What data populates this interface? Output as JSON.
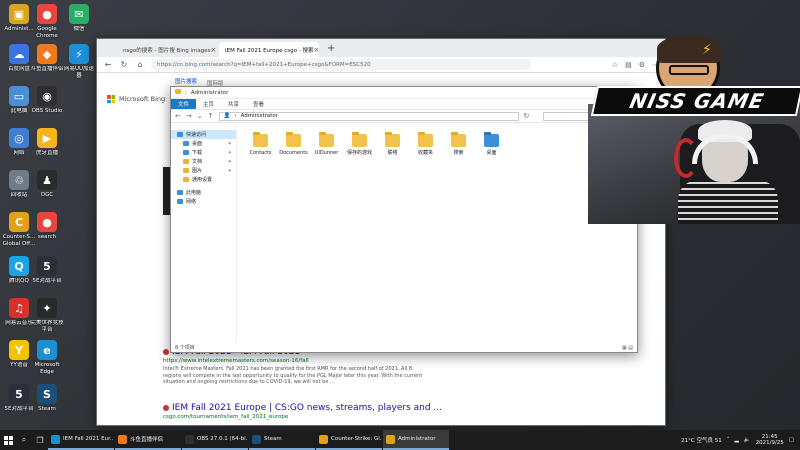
{
  "desktop": {
    "icons": [
      {
        "label": "Administ...",
        "color": "#d9a521",
        "glyph": "▣"
      },
      {
        "label": "Google Chrome",
        "color": "#e8453c",
        "glyph": "●"
      },
      {
        "label": "微信",
        "color": "#2aae67",
        "glyph": "✉"
      },
      {
        "label": "百度网盘",
        "color": "#3a74e0",
        "glyph": "☁"
      },
      {
        "label": "斗鱼直播伴侣",
        "color": "#f07a1b",
        "glyph": "◆"
      },
      {
        "label": "网易UU加速器",
        "color": "#1c8fd8",
        "glyph": "⚡"
      },
      {
        "label": "此电脑",
        "color": "#4a8fd6",
        "glyph": "▭"
      },
      {
        "label": "OBS Studio",
        "color": "#302e31",
        "glyph": "◉"
      },
      {
        "label": "网络",
        "color": "#3f7ed1",
        "glyph": "◎"
      },
      {
        "label": "虎牙直播",
        "color": "#f4b41a",
        "glyph": "▶"
      },
      {
        "label": "回收站",
        "color": "#6f7b86",
        "glyph": "♲"
      },
      {
        "label": "OGC",
        "color": "#2b2b2b",
        "glyph": "♟"
      },
      {
        "label": "Counter-S... Global Off...",
        "color": "#e3a01b",
        "glyph": "C"
      },
      {
        "label": "search",
        "color": "#e8453c",
        "glyph": "●"
      },
      {
        "label": "腾讯QQ",
        "color": "#1aa3e6",
        "glyph": "Q"
      },
      {
        "label": "5E对战平台",
        "color": "#2a2f3a",
        "glyph": "5"
      },
      {
        "label": "网易云音乐",
        "color": "#d9302b",
        "glyph": "♫"
      },
      {
        "label": "完美世界竞技平台",
        "color": "#2a2a2a",
        "glyph": "✦"
      },
      {
        "label": "YY语音",
        "color": "#f5c400",
        "glyph": "Y"
      },
      {
        "label": "Microsoft Edge",
        "color": "#1b8fcf",
        "glyph": "e"
      },
      {
        "label": "5E对战平台",
        "color": "#2a2f3a",
        "glyph": "5"
      },
      {
        "label": "Steam",
        "color": "#1b4f78",
        "glyph": "S"
      }
    ]
  },
  "browser": {
    "tabs": [
      {
        "label": "nsgo的搜索 - 图片搜 Bing images"
      },
      {
        "label": "IEM Fall 2021 Europe csgo - 搜索"
      }
    ],
    "new_tab": "+",
    "url": "https://cn.bing.com/search?q=IEM+fall+2021+Europe+csgo&FORM=ESC520",
    "bing_tabs": [
      "图片搜索",
      "国际版"
    ],
    "bing_logo": "Microsoft Bing",
    "results": [
      {
        "title": "IEM Fall 2021 - IEM Fall 2021",
        "site": "https://www.intelextrememasters.com/season-16/fall",
        "snippet": "Intel® Extreme Masters. Fall 2021 has been granted the first RMR for the second half of 2021. All 8 regions will compete in the last opportunity to qualify for the PGL Major later this year. With the current situation and ongoing restrictions due to COVID-19, we will not be ..."
      },
      {
        "title": "IEM Fall 2021 Europe | CS:GO    news, streams, players and ...",
        "site": "csgo.com/tournaments/iem_fall_2021_europe",
        "snippet": ""
      }
    ]
  },
  "explorer": {
    "title": "Administrator",
    "ribbon_tabs": [
      "文件",
      "主页",
      "共享",
      "查看"
    ],
    "path": "Administrator",
    "sidebar": [
      {
        "label": "快速访问",
        "kind": "blue",
        "selected": true,
        "child": false,
        "pin": false
      },
      {
        "label": "桌面",
        "kind": "blue",
        "selected": false,
        "child": true,
        "pin": true
      },
      {
        "label": "下载",
        "kind": "blue",
        "selected": false,
        "child": true,
        "pin": true
      },
      {
        "label": "文档",
        "kind": "yellow",
        "selected": false,
        "child": true,
        "pin": true
      },
      {
        "label": "图片",
        "kind": "yellow",
        "selected": false,
        "child": true,
        "pin": true
      },
      {
        "label": "通用设置",
        "kind": "yellow",
        "selected": false,
        "child": true,
        "pin": false
      },
      {
        "label": "此电脑",
        "kind": "blue",
        "selected": false,
        "child": false,
        "pin": false
      },
      {
        "label": "网络",
        "kind": "blue",
        "selected": false,
        "child": false,
        "pin": false
      }
    ],
    "folders": [
      {
        "label": "Contacts",
        "color": "yellow"
      },
      {
        "label": "Documents",
        "color": "yellow"
      },
      {
        "label": "UIDunner",
        "color": "yellow"
      },
      {
        "label": "保存的游戏",
        "color": "yellow"
      },
      {
        "label": "联络",
        "color": "yellow"
      },
      {
        "label": "收藏夹",
        "color": "yellow"
      },
      {
        "label": "搜索",
        "color": "yellow"
      },
      {
        "label": "桌面",
        "color": "blue"
      }
    ],
    "status": "8 个项目"
  },
  "overlay": {
    "logo_text": "NISS GAME"
  },
  "taskbar": {
    "apps": [
      {
        "label": "IEM Fall 2021 Eur...",
        "color": "#1b8fcf",
        "active": false
      },
      {
        "label": "斗鱼直播伴侣",
        "color": "#f07a1b",
        "active": false
      },
      {
        "label": "OBS 27.0.1 (64-bi...",
        "color": "#302e31",
        "active": false
      },
      {
        "label": "Steam",
        "color": "#1b4f78",
        "active": false
      },
      {
        "label": "Counter-Strike: Gl...",
        "color": "#e3a01b",
        "active": false
      },
      {
        "label": "Administrator",
        "color": "#d9a521",
        "active": true
      }
    ],
    "weather": "21°C 空气良 51",
    "time": "21:45",
    "date": "2021/9/25"
  }
}
